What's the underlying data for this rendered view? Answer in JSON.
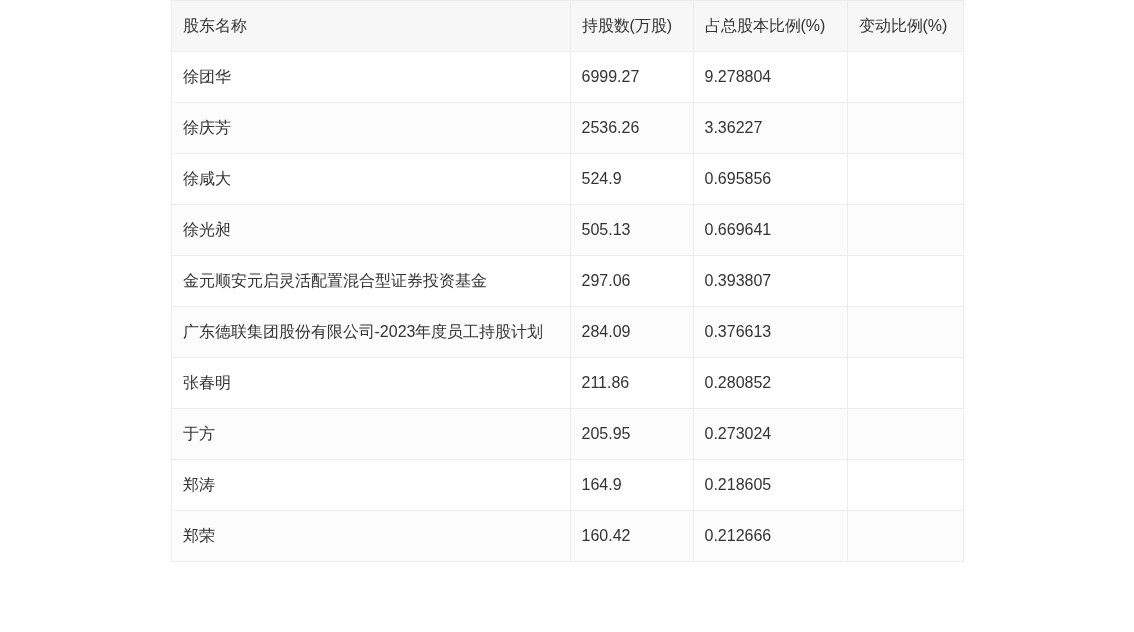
{
  "table": {
    "columns": [
      "股东名称",
      "持股数(万股)",
      "占总股本比例(%)",
      "变动比例(%)"
    ],
    "rows": [
      {
        "name": "徐团华",
        "shares": "6999.27",
        "ratio": "9.278804"
      },
      {
        "name": "徐庆芳",
        "shares": "2536.26",
        "ratio": "3.36227"
      },
      {
        "name": "徐咸大",
        "shares": "524.9",
        "ratio": "0.695856"
      },
      {
        "name": "徐光昶",
        "shares": "505.13",
        "ratio": "0.669641"
      },
      {
        "name": "金元顺安元启灵活配置混合型证券投资基金",
        "shares": "297.06",
        "ratio": "0.393807"
      },
      {
        "name": "广东德联集团股份有限公司-2023年度员工持股计划",
        "shares": "284.09",
        "ratio": "0.376613"
      },
      {
        "name": "张春明",
        "shares": "211.86",
        "ratio": "0.280852"
      },
      {
        "name": "于方",
        "shares": "205.95",
        "ratio": "0.273024"
      },
      {
        "name": "郑涛",
        "shares": "164.9",
        "ratio": "0.218605"
      },
      {
        "name": "郑荣",
        "shares": "160.42",
        "ratio": "0.212666"
      }
    ]
  }
}
